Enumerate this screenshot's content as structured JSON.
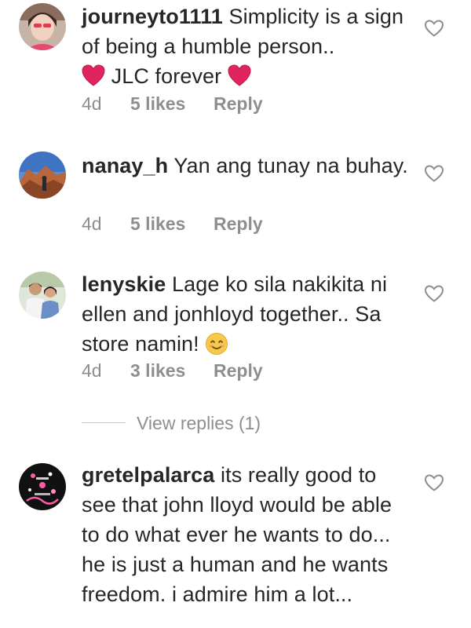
{
  "comments": [
    {
      "username": "journeyto1111",
      "text_before": "Simplicity is a sign of being a humble person..",
      "text_middle": "JLC forever",
      "time": "4d",
      "likes": "5 likes",
      "reply": "Reply",
      "avatar_icon": "profile-photo-woman-red",
      "inline_emoji": "red-heart-emoji"
    },
    {
      "username": "nanay_h",
      "text": "Yan ang tunay na buhay.",
      "time": "4d",
      "likes": "5 likes",
      "reply": "Reply",
      "avatar_icon": "profile-photo-canyon"
    },
    {
      "username": "lenyskie",
      "text": "Lage ko sila nakikita ni ellen and jonhloyd together.. Sa store namin!",
      "time": "4d",
      "likes": "3 likes",
      "reply": "Reply",
      "avatar_icon": "profile-photo-couple",
      "inline_emoji": "smiling-face-emoji"
    },
    {
      "username": "gretelpalarca",
      "text": "its really good to see that  john lloyd would be able to do what ever he wants to do... he is just a human and he wants freedom. i admire him a lot...",
      "avatar_icon": "profile-photo-pink-graphic"
    }
  ],
  "view_replies": "View replies (1)",
  "icons": {
    "like": "heart-outline-icon"
  },
  "colors": {
    "text": "#262626",
    "meta": "#8e8e8e",
    "emoji_heart": "#e0245e",
    "emoji_smile": "#f7c948"
  }
}
